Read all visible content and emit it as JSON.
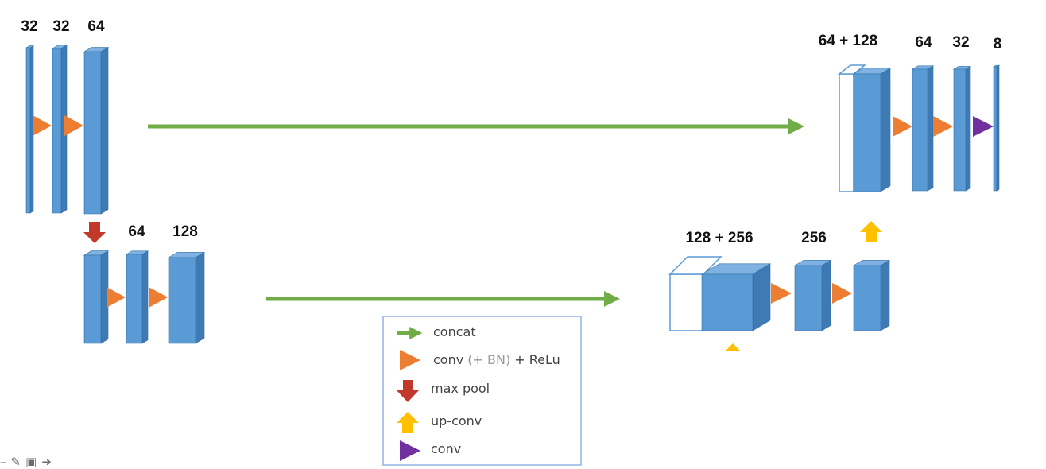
{
  "colors": {
    "block_front": "#5b9bd5",
    "block_side": "#3f7ab5",
    "block_top": "#7fb2e2",
    "block_edge": "#2e6da4",
    "conv_relu": "#ed7d31",
    "max_pool": "#c0392b",
    "up_conv": "#ffc000",
    "conv": "#7030a0",
    "concat": "#70ad47",
    "legend_border": "#8eb4e3"
  },
  "encoder_level1": {
    "channels": [
      "32",
      "32",
      "64"
    ]
  },
  "encoder_level2": {
    "channels": [
      "64",
      "128"
    ]
  },
  "decoder_level2": {
    "channels": [
      "128 + 256",
      "256"
    ]
  },
  "decoder_level1": {
    "channels": [
      "64 + 128",
      "64",
      "32",
      "8"
    ]
  },
  "legend": {
    "items": [
      {
        "icon": "green-arrow-icon",
        "label": "concat"
      },
      {
        "icon": "orange-triangle-icon",
        "label_parts": [
          "conv ",
          "(+ BN)",
          " + ReLu"
        ]
      },
      {
        "icon": "red-down-arrow-icon",
        "label": "max pool"
      },
      {
        "icon": "yellow-up-arrow-icon",
        "label": "up-conv"
      },
      {
        "icon": "purple-triangle-icon",
        "label": "conv"
      }
    ]
  },
  "toolbar": {
    "icons": [
      "dash-icon",
      "pencil-icon",
      "window-icon",
      "forward-arrow-icon"
    ]
  }
}
